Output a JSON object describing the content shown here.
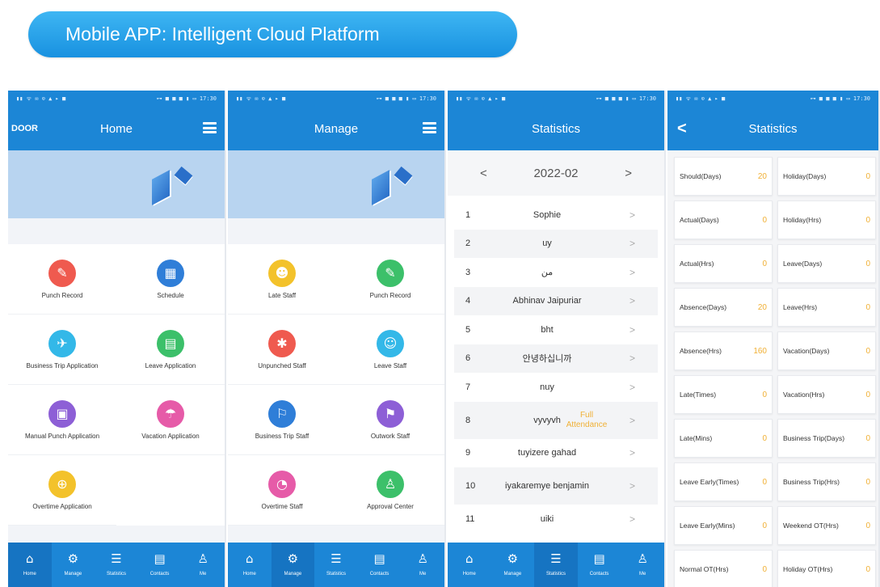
{
  "banner": {
    "title": "Mobile APP: Intelligent Cloud Platform"
  },
  "status_bar": {
    "left": "▮▮ ᯤ ✉ ⊙ ▲ ▸ ■",
    "right": "⊶ ■ ■ ■ ▮ ▭ 17:30"
  },
  "phone1": {
    "brand": "DOOR",
    "title": "Home",
    "items": [
      {
        "label": "Punch Record",
        "icon": "✎",
        "color": "#ef5a4f"
      },
      {
        "label": "Schedule",
        "icon": "▦",
        "color": "#2f7ed8"
      },
      {
        "label": "Business Trip Application",
        "icon": "✈",
        "color": "#33b8e8"
      },
      {
        "label": "Leave Application",
        "icon": "▤",
        "color": "#3cc06a"
      },
      {
        "label": "Manual Punch Application",
        "icon": "▣",
        "color": "#8d5fd6"
      },
      {
        "label": "Vacation Application",
        "icon": "☂",
        "color": "#e65ba8"
      },
      {
        "label": "Overtime Application",
        "icon": "⊕",
        "color": "#f3c22b"
      }
    ]
  },
  "phone2": {
    "title": "Manage",
    "items": [
      {
        "label": "Late Staff",
        "icon": "☻",
        "color": "#f3c22b"
      },
      {
        "label": "Punch Record",
        "icon": "✎",
        "color": "#3cc06a"
      },
      {
        "label": "Unpunched Staff",
        "icon": "✱",
        "color": "#ef5a4f"
      },
      {
        "label": "Leave Staff",
        "icon": "☺",
        "color": "#33b8e8"
      },
      {
        "label": "Business Trip Staff",
        "icon": "⚐",
        "color": "#2f7ed8"
      },
      {
        "label": "Outwork Staff",
        "icon": "⚑",
        "color": "#8d5fd6"
      },
      {
        "label": "Overtime Staff",
        "icon": "◔",
        "color": "#e65ba8"
      },
      {
        "label": "Approval Center",
        "icon": "♙",
        "color": "#3cc06a"
      }
    ]
  },
  "phone3": {
    "title": "Statistics",
    "month": "2022-02",
    "prev": "<",
    "next": ">",
    "rows": [
      {
        "n": "1",
        "name": "Sophie",
        "extra": ""
      },
      {
        "n": "2",
        "name": "uy",
        "extra": ""
      },
      {
        "n": "3",
        "name": "من",
        "extra": ""
      },
      {
        "n": "4",
        "name": "Abhinav Jaipuriar",
        "extra": ""
      },
      {
        "n": "5",
        "name": "bht",
        "extra": ""
      },
      {
        "n": "6",
        "name": "안녕하십니까",
        "extra": ""
      },
      {
        "n": "7",
        "name": "nuy",
        "extra": ""
      },
      {
        "n": "8",
        "name": "vyvyvh",
        "extra": "Full Attendance"
      },
      {
        "n": "9",
        "name": "tuyizere gahad",
        "extra": ""
      },
      {
        "n": "10",
        "name": "iyakaremye benjamin",
        "extra": ""
      },
      {
        "n": "11",
        "name": "uiki",
        "extra": ""
      }
    ]
  },
  "phone4": {
    "title": "Statistics",
    "back": "<",
    "tiles": [
      {
        "label": "Should(Days)",
        "value": "20"
      },
      {
        "label": "Holiday(Days)",
        "value": "0"
      },
      {
        "label": "Actual(Days)",
        "value": "0"
      },
      {
        "label": "Holiday(Hrs)",
        "value": "0"
      },
      {
        "label": "Actual(Hrs)",
        "value": "0"
      },
      {
        "label": "Leave(Days)",
        "value": "0"
      },
      {
        "label": "Absence(Days)",
        "value": "20"
      },
      {
        "label": "Leave(Hrs)",
        "value": "0"
      },
      {
        "label": "Absence(Hrs)",
        "value": "160"
      },
      {
        "label": "Vacation(Days)",
        "value": "0"
      },
      {
        "label": "Late(Times)",
        "value": "0"
      },
      {
        "label": "Vacation(Hrs)",
        "value": "0"
      },
      {
        "label": "Late(Mins)",
        "value": "0"
      },
      {
        "label": "Business Trip(Days)",
        "value": "0"
      },
      {
        "label": "Leave Early(Times)",
        "value": "0"
      },
      {
        "label": "Business Trip(Hrs)",
        "value": "0"
      },
      {
        "label": "Leave Early(Mins)",
        "value": "0"
      },
      {
        "label": "Weekend OT(Hrs)",
        "value": "0"
      },
      {
        "label": "Normal OT(Hrs)",
        "value": "0"
      },
      {
        "label": "Holiday OT(Hrs)",
        "value": "0"
      }
    ]
  },
  "tabs": [
    {
      "label": "Home",
      "icon": "⌂"
    },
    {
      "label": "Manage",
      "icon": "⚙"
    },
    {
      "label": "Statistics",
      "icon": "☰"
    },
    {
      "label": "Contacts",
      "icon": "▤"
    },
    {
      "label": "Me",
      "icon": "♙"
    }
  ],
  "active_tab": {
    "phone1": 0,
    "phone2": 1,
    "phone3": 2
  }
}
